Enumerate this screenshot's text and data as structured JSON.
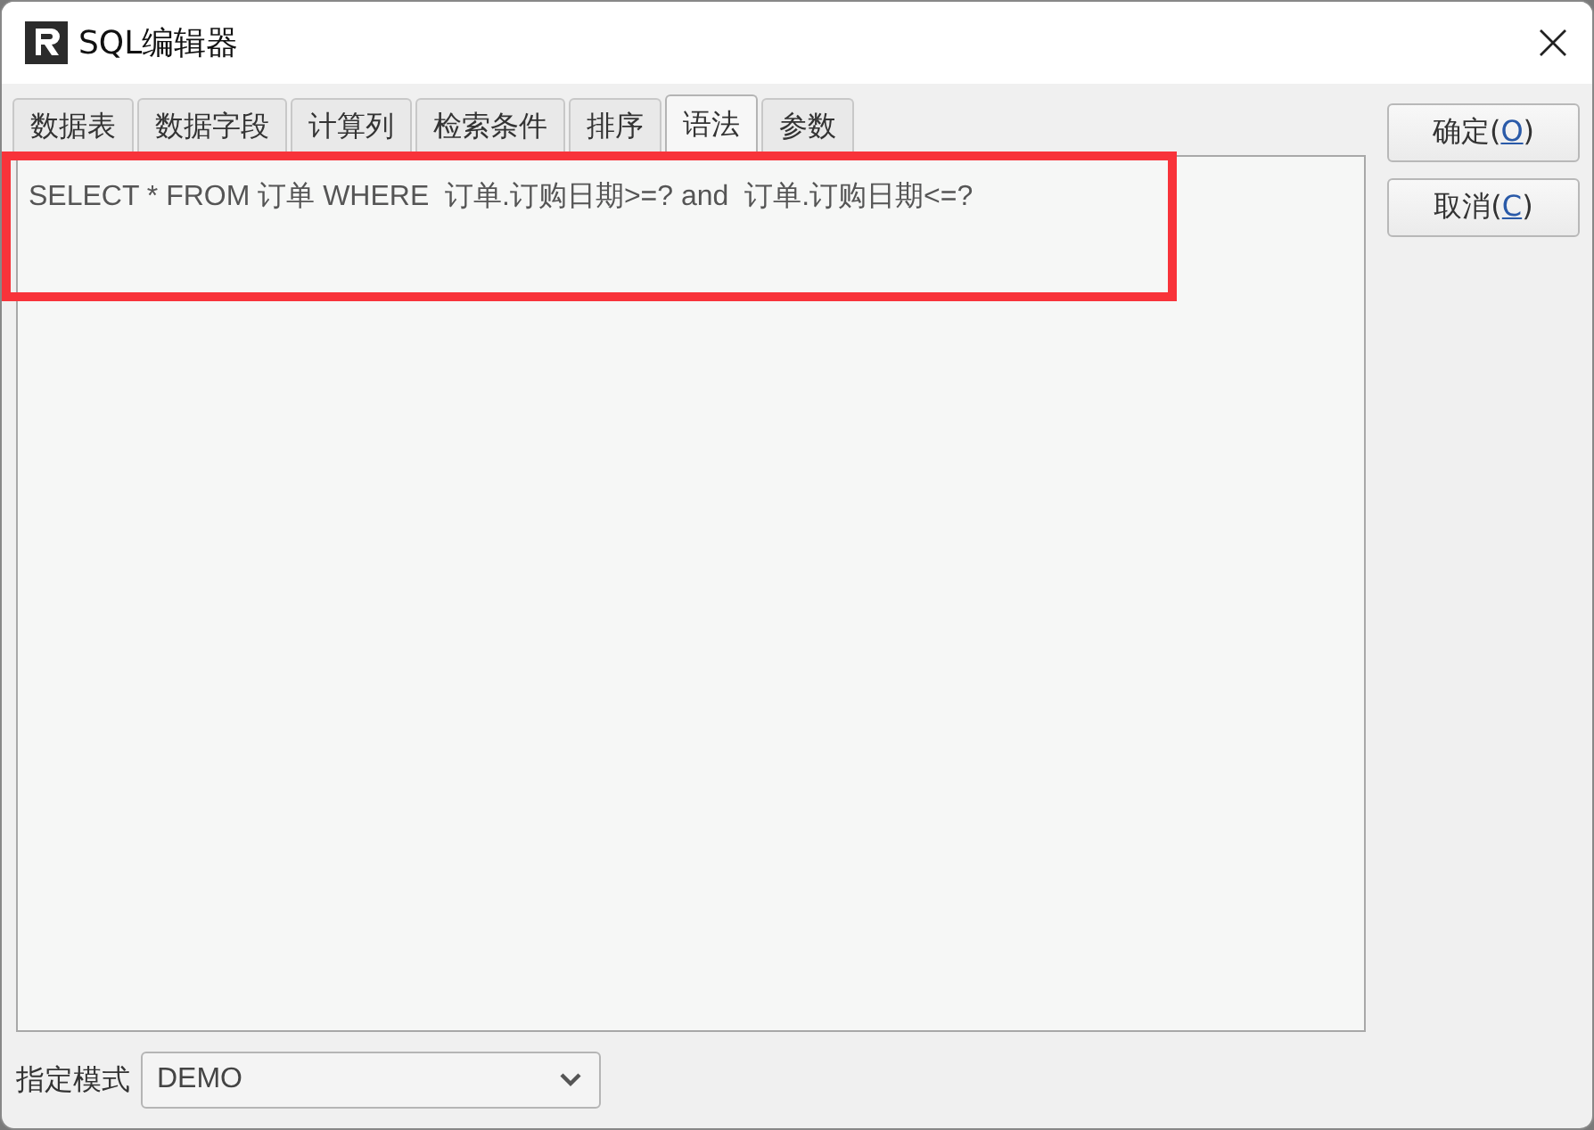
{
  "window": {
    "title": "SQL编辑器"
  },
  "tabs": [
    {
      "label": "数据表",
      "selected": false
    },
    {
      "label": "数据字段",
      "selected": false
    },
    {
      "label": "计算列",
      "selected": false
    },
    {
      "label": "检索条件",
      "selected": false
    },
    {
      "label": "排序",
      "selected": false
    },
    {
      "label": "语法",
      "selected": true
    },
    {
      "label": "参数",
      "selected": false
    }
  ],
  "sql_text": "SELECT * FROM 订单 WHERE  订单.订购日期>=? and  订单.订购日期<=?",
  "buttons": [
    {
      "label_start": "确定(",
      "mnemonic": "O",
      "label_end": ")"
    },
    {
      "label_start": "取消(",
      "mnemonic": "C",
      "label_end": ")"
    }
  ],
  "schema": {
    "label": "指定模式",
    "value": "DEMO"
  }
}
